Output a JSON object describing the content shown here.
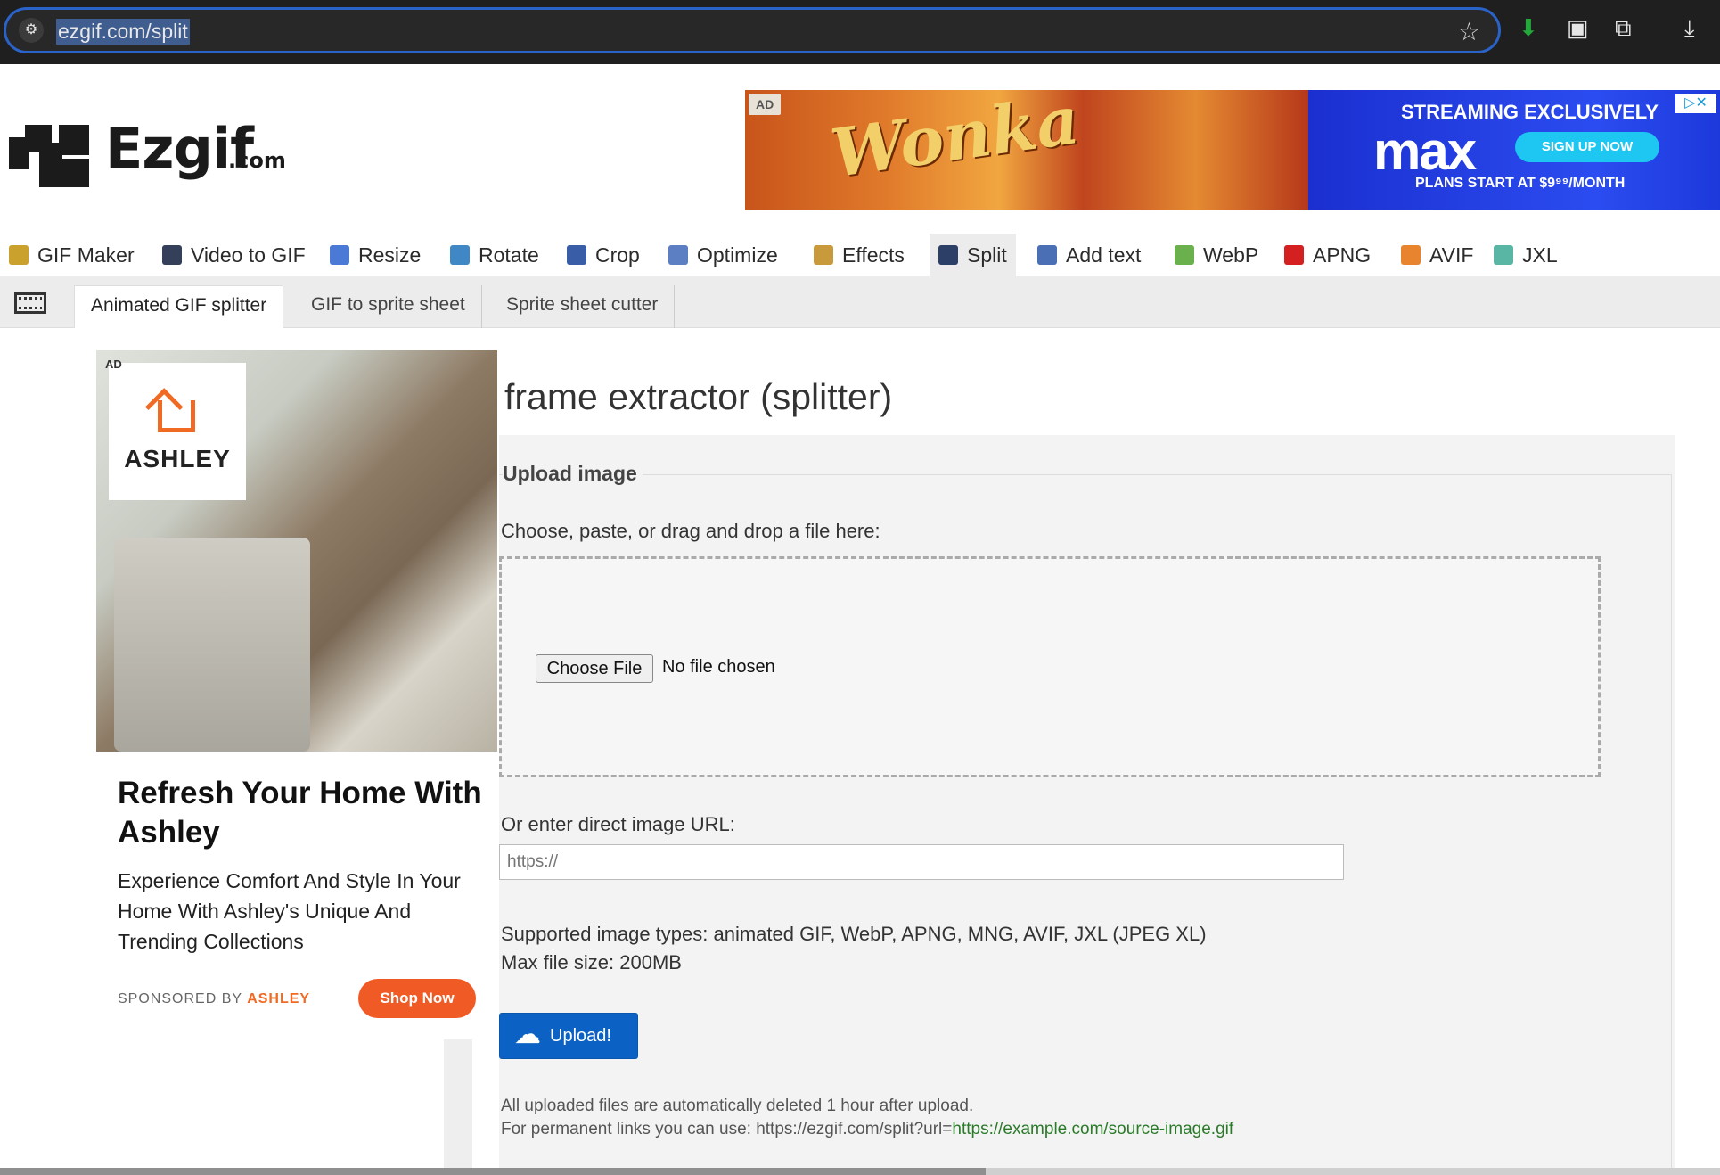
{
  "browser": {
    "url": "ezgif.com/split",
    "site_info_icon": "site-info-icon",
    "star_icon": "bookmark-star-icon"
  },
  "logo": {
    "text": "Ezgif",
    "suffix": ".com"
  },
  "top_ad": {
    "tag": "AD",
    "brand_art": "Wonka",
    "headline": "STREAMING EXCLUSIVELY",
    "brand": "max",
    "cta": "SIGN UP NOW",
    "price": "PLANS START AT $9⁹⁹/MONTH",
    "close": "▷✕"
  },
  "nav": {
    "items": [
      {
        "label": "GIF Maker",
        "icon": "gif-maker-icon",
        "color": "#c9a12c"
      },
      {
        "label": "Video to GIF",
        "icon": "video-icon",
        "color": "#34405a"
      },
      {
        "label": "Resize",
        "icon": "resize-icon",
        "color": "#4a7ad6"
      },
      {
        "label": "Rotate",
        "icon": "rotate-icon",
        "color": "#3f88c5"
      },
      {
        "label": "Crop",
        "icon": "crop-icon",
        "color": "#3a5da8"
      },
      {
        "label": "Optimize",
        "icon": "optimize-icon",
        "color": "#5b7fc2"
      },
      {
        "label": "Effects",
        "icon": "effects-icon",
        "color": "#c99a3b"
      },
      {
        "label": "Split",
        "icon": "split-icon",
        "color": "#2c3f66"
      },
      {
        "label": "Add text",
        "icon": "add-text-icon",
        "color": "#4a6fb5"
      },
      {
        "label": "WebP",
        "icon": "webp-icon",
        "color": "#6ab04c"
      },
      {
        "label": "APNG",
        "icon": "apng-icon",
        "color": "#d42020"
      },
      {
        "label": "AVIF",
        "icon": "avif-icon",
        "color": "#e8842d"
      },
      {
        "label": "JXL",
        "icon": "jxl-icon",
        "color": "#59b6a4"
      }
    ]
  },
  "subnav": {
    "items": [
      "Animated GIF splitter",
      "GIF to sprite sheet",
      "Sprite sheet cutter"
    ]
  },
  "side_ad": {
    "tag": "AD",
    "logo_text": "ASHLEY",
    "headline": "Refresh Your Home With Ashley",
    "body": "Experience Comfort And Style In Your Home With Ashley's Unique And Trending Collections",
    "sponsored_prefix": "SPONSORED BY",
    "sponsor": "ASHLEY",
    "cta": "Shop Now"
  },
  "main": {
    "title": "frame extractor (splitter)",
    "legend": "Upload image",
    "choose_label": "Choose, paste, or drag and drop a file here:",
    "file_button": "Choose File",
    "file_status": "No file chosen",
    "url_label": "Or enter direct image URL:",
    "url_placeholder": "https://",
    "supported": "Supported image types: animated GIF, WebP, APNG, MNG, AVIF, JXL (JPEG XL)",
    "max_size": "Max file size: 200MB",
    "upload_button": "Upload!",
    "note_line1": "All uploaded files are automatically deleted 1 hour after upload.",
    "note_line2_prefix": "For permanent links you can use: https://ezgif.com/split?url=",
    "note_line2_link": "https://example.com/source-image.gif"
  }
}
